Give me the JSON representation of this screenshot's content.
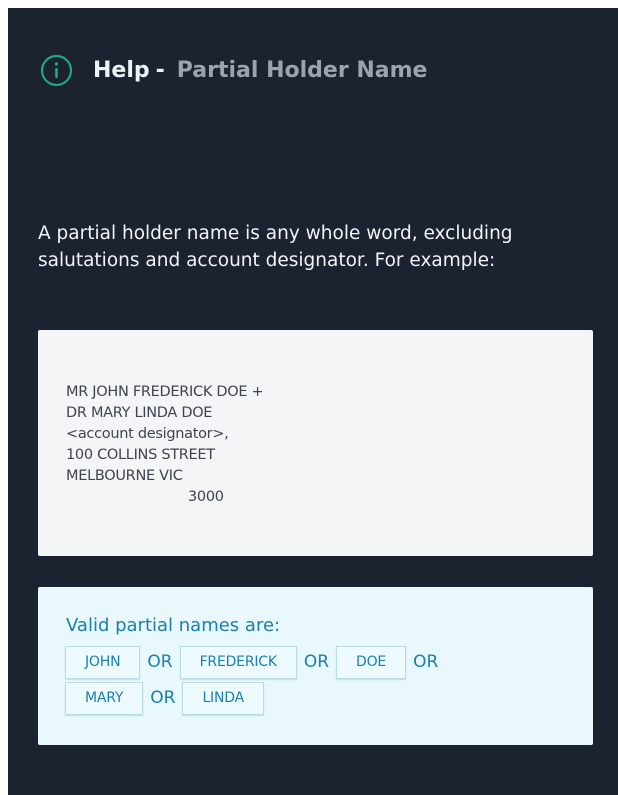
{
  "header": {
    "icon": "info-icon",
    "icon_color": "#1ea886",
    "title": "Help",
    "separator": "-",
    "subtitle": "Partial Holder Name"
  },
  "intro": {
    "text": "A partial holder name is any whole word, excluding salutations and account designator. For example:"
  },
  "example": {
    "lines": [
      "MR JOHN FREDERICK DOE +",
      "DR MARY LINDA DOE",
      "<account designator>,",
      "100 COLLINS STREET",
      "MELBOURNE VIC",
      "3000"
    ]
  },
  "valid": {
    "heading": "Valid partial names are:",
    "names": [
      "JOHN",
      "FREDERICK",
      "DOE",
      "MARY",
      "LINDA"
    ],
    "or_label": "OR",
    "accent_color": "#1a7fb0"
  }
}
